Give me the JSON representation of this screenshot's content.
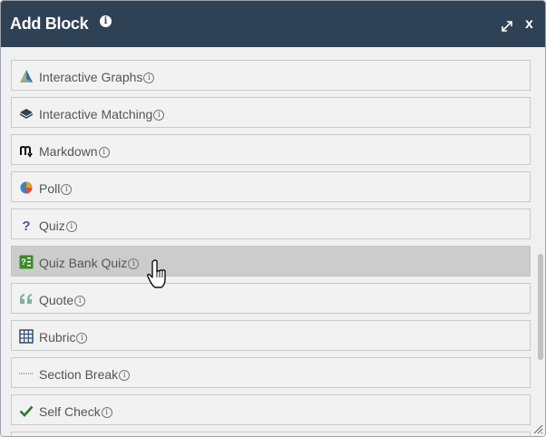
{
  "dialog": {
    "title": "Add Block",
    "info_icon_text": "i",
    "close_label": "x"
  },
  "items": [
    {
      "label": "Interactive Graphs",
      "icon": "graph-icon"
    },
    {
      "label": "Interactive Matching",
      "icon": "matching-icon"
    },
    {
      "label": "Markdown",
      "icon": "markdown-icon"
    },
    {
      "label": "Poll",
      "icon": "pie-icon"
    },
    {
      "label": "Quiz",
      "icon": "question-icon"
    },
    {
      "label": "Quiz Bank Quiz",
      "icon": "quiz-bank-icon",
      "state": "hovered"
    },
    {
      "label": "Quote",
      "icon": "quote-icon"
    },
    {
      "label": "Rubric",
      "icon": "table-icon"
    },
    {
      "label": "Section Break",
      "icon": "dotted-line-icon"
    },
    {
      "label": "Self Check",
      "icon": "checkmark-icon"
    }
  ],
  "info_glyph": "i",
  "colors": {
    "titlebar": "#2f4155",
    "hover_row": "#cccccc",
    "quiz_purple": "#6a3fa0",
    "quiz_bank_green": "#3c8a2e",
    "check_green": "#2a7a2a",
    "quote_teal": "#7ab3a2"
  }
}
